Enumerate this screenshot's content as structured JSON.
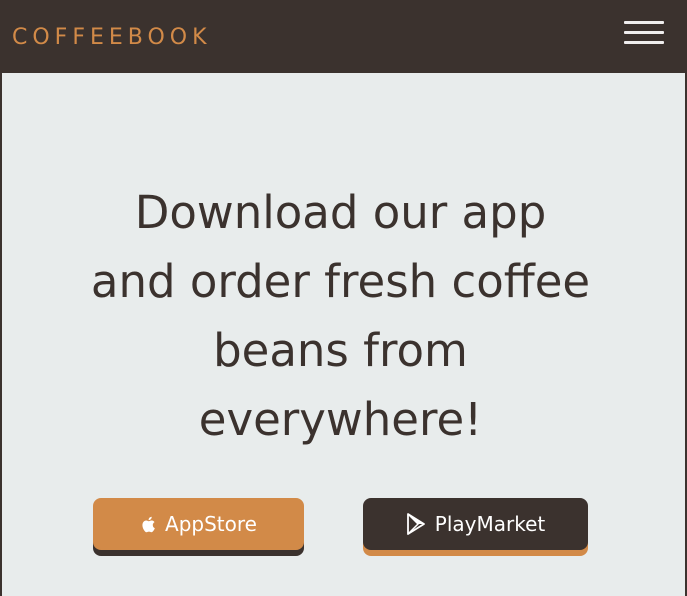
{
  "header": {
    "brand": "COFFEEBOOK",
    "menu_icon": "hamburger-menu-icon"
  },
  "hero": {
    "headline": "Download our app and order fresh coffee beans from everywhere!"
  },
  "buttons": {
    "appstore": {
      "label": "AppStore",
      "icon": "apple-icon"
    },
    "playmarket": {
      "label": "PlayMarket",
      "icon": "play-store-icon"
    }
  },
  "colors": {
    "brand_accent": "#d28a48",
    "dark": "#3b322e",
    "background": "#e8ecec"
  }
}
